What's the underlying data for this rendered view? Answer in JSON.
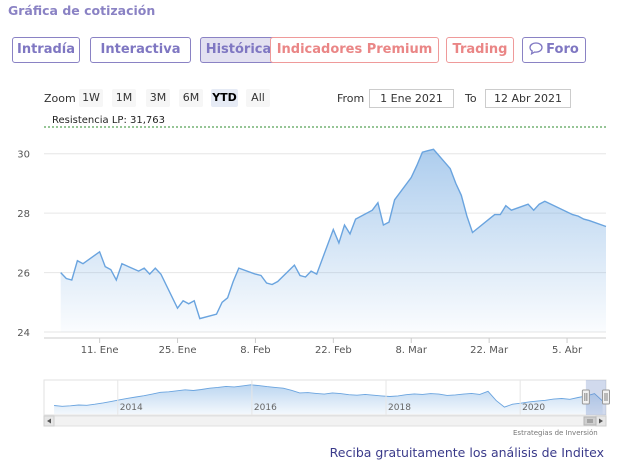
{
  "header": {
    "title": "Gráfica de cotización"
  },
  "tabs": [
    {
      "label": "Intradía",
      "style": "normal"
    },
    {
      "label": "Interactiva",
      "style": "normal"
    },
    {
      "label": "Histórica",
      "style": "active"
    },
    {
      "label": "Indicadores Premium",
      "style": "premium"
    },
    {
      "label": "Trading",
      "style": "premium"
    },
    {
      "label": "Foro",
      "style": "normal",
      "icon": "chat-bubble-icon"
    }
  ],
  "range_selector": {
    "zoom_label": "Zoom",
    "buttons": [
      "1W",
      "1M",
      "3M",
      "6M",
      "YTD",
      "All"
    ],
    "selected": "YTD",
    "from_label": "From",
    "from_value": "1 Ene 2021",
    "to_label": "To",
    "to_value": "12 Abr 2021"
  },
  "colors": {
    "accent": "#8a82c4",
    "premium": "#ea8686",
    "series_line": "#6aa4df",
    "resistance_line": "#2e8b2e"
  },
  "chart_data": {
    "type": "area",
    "x": [
      "2021-01-04",
      "2021-01-05",
      "2021-01-06",
      "2021-01-07",
      "2021-01-08",
      "2021-01-11",
      "2021-01-12",
      "2021-01-13",
      "2021-01-14",
      "2021-01-15",
      "2021-01-18",
      "2021-01-19",
      "2021-01-20",
      "2021-01-21",
      "2021-01-22",
      "2021-01-25",
      "2021-01-26",
      "2021-01-27",
      "2021-01-28",
      "2021-01-29",
      "2021-02-01",
      "2021-02-02",
      "2021-02-03",
      "2021-02-04",
      "2021-02-05",
      "2021-02-08",
      "2021-02-09",
      "2021-02-10",
      "2021-02-11",
      "2021-02-12",
      "2021-02-15",
      "2021-02-16",
      "2021-02-17",
      "2021-02-18",
      "2021-02-19",
      "2021-02-22",
      "2021-02-23",
      "2021-02-24",
      "2021-02-25",
      "2021-02-26",
      "2021-03-01",
      "2021-03-02",
      "2021-03-03",
      "2021-03-04",
      "2021-03-05",
      "2021-03-08",
      "2021-03-09",
      "2021-03-10",
      "2021-03-11",
      "2021-03-12",
      "2021-03-15",
      "2021-03-16",
      "2021-03-17",
      "2021-03-18",
      "2021-03-19",
      "2021-03-22",
      "2021-03-23",
      "2021-03-24",
      "2021-03-25",
      "2021-03-26",
      "2021-03-29",
      "2021-03-30",
      "2021-03-31",
      "2021-04-01",
      "2021-04-06",
      "2021-04-07",
      "2021-04-08",
      "2021-04-09",
      "2021-04-12"
    ],
    "series": [
      {
        "values": [
          26.0,
          25.8,
          25.75,
          26.4,
          26.3,
          26.7,
          26.2,
          26.1,
          25.75,
          26.3,
          26.05,
          26.15,
          25.95,
          26.15,
          25.95,
          24.8,
          25.05,
          24.95,
          25.05,
          24.45,
          24.6,
          25.0,
          25.15,
          25.7,
          26.15,
          25.95,
          25.9,
          25.65,
          25.6,
          25.7,
          26.25,
          25.9,
          25.85,
          26.05,
          25.95,
          27.45,
          27.0,
          27.6,
          27.3,
          27.8,
          28.1,
          28.35,
          27.6,
          27.7,
          28.45,
          29.2,
          29.6,
          30.05,
          30.1,
          30.15,
          29.5,
          29.0,
          28.6,
          27.9,
          27.35,
          27.8,
          27.95,
          27.95,
          28.25,
          28.1,
          28.3,
          28.1,
          28.3,
          28.4,
          27.95,
          27.9,
          27.8,
          27.75,
          27.55
        ]
      }
    ],
    "xlim": [
      "2021-01-01",
      "2021-04-12"
    ],
    "ylim": [
      24,
      31
    ],
    "y_ticks": [
      24,
      26,
      28,
      30
    ],
    "x_tick_labels": [
      {
        "date": "2021-01-11",
        "label": "11. Ene"
      },
      {
        "date": "2021-01-25",
        "label": "25. Ene"
      },
      {
        "date": "2021-02-08",
        "label": "8. Feb"
      },
      {
        "date": "2021-02-22",
        "label": "22. Feb"
      },
      {
        "date": "2021-03-08",
        "label": "8. Mar"
      },
      {
        "date": "2021-03-22",
        "label": "22. Mar"
      },
      {
        "date": "2021-04-05",
        "label": "5. Abr"
      }
    ],
    "plot_line": {
      "label": "Resistencia LP: 31,763",
      "value": 31.763
    },
    "grid": "horizontal",
    "legend": "none"
  },
  "navigator": {
    "year_labels": [
      "2014",
      "2016",
      "2018",
      "2020"
    ],
    "x_range": [
      2012.9,
      2021.28
    ],
    "year_ticks": [
      2014,
      2016,
      2018,
      2020
    ],
    "values": [
      25.9,
      25.6,
      25.8,
      26.1,
      26.0,
      26.4,
      26.9,
      27.5,
      28.1,
      28.7,
      29.2,
      29.7,
      30.3,
      31.0,
      31.2,
      31.6,
      32.0,
      31.7,
      32.1,
      32.6,
      32.9,
      33.3,
      33.1,
      33.5,
      33.9,
      33.6,
      33.2,
      32.9,
      32.6,
      31.8,
      30.8,
      30.9,
      30.6,
      30.3,
      30.8,
      30.5,
      30.1,
      29.9,
      30.2,
      29.9,
      29.6,
      29.4,
      29.6,
      30.1,
      30.4,
      30.2,
      30.5,
      30.3,
      29.8,
      30.0,
      30.3,
      30.6,
      30.2,
      31.4,
      27.8,
      25.3,
      26.4,
      26.8,
      27.3,
      27.6,
      27.9,
      28.4,
      28.6,
      28.3,
      29.0,
      29.6,
      30.5,
      27.6
    ],
    "selection": {
      "from": 2020.98,
      "to": 2021.28
    },
    "handle_icon": "scroll-grip-icon",
    "left_arrow": "scroll-left-icon",
    "right_arrow": "scroll-right-icon"
  },
  "credits": "Estrategias de Inversión",
  "cta": "Reciba gratuitamente los análisis de Inditex"
}
